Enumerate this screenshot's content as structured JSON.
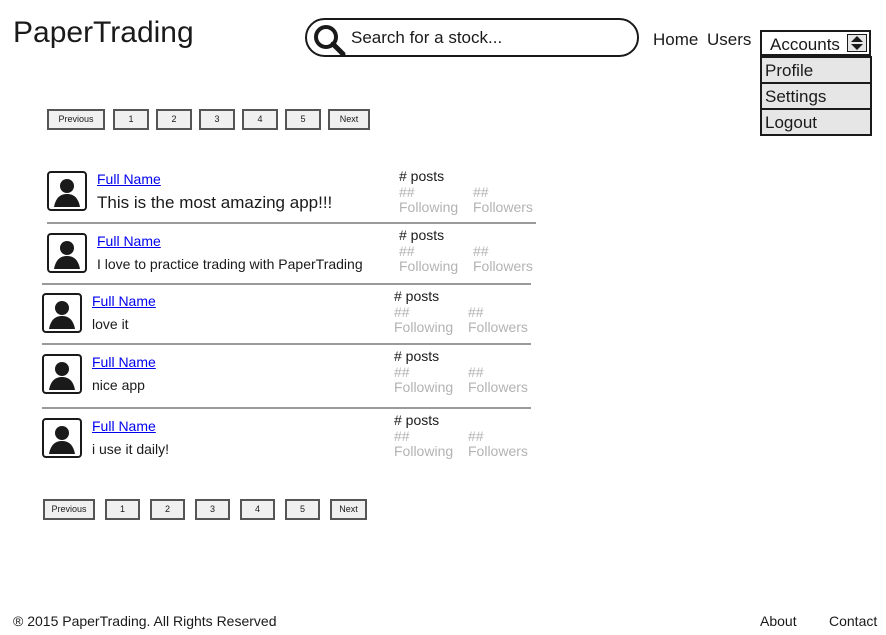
{
  "header": {
    "logo": "PaperTrading",
    "search_placeholder": "Search for a stock...",
    "nav": {
      "home": "Home",
      "users": "Users"
    },
    "accounts": {
      "label": "Accounts",
      "menu": [
        "Profile",
        "Settings",
        "Logout"
      ]
    }
  },
  "pager_top": {
    "previous": "Previous",
    "pages": [
      "1",
      "2",
      "3",
      "4",
      "5"
    ],
    "next": "Next"
  },
  "pager_bottom": {
    "previous": "Previous",
    "pages": [
      "1",
      "2",
      "3",
      "4",
      "5"
    ],
    "next": "Next"
  },
  "posts": [
    {
      "name": "Full Name",
      "text": "This is the most amazing app!!!",
      "posts_label": "# posts",
      "following_count": "##",
      "following_label": "Following",
      "followers_count": "##",
      "followers_label": "Followers"
    },
    {
      "name": "Full Name",
      "text": "I love to practice trading with PaperTrading",
      "posts_label": "# posts",
      "following_count": "##",
      "following_label": "Following",
      "followers_count": "##",
      "followers_label": "Followers"
    },
    {
      "name": "Full Name",
      "text": "love it",
      "posts_label": "# posts",
      "following_count": "##",
      "following_label": "Following",
      "followers_count": "##",
      "followers_label": "Followers"
    },
    {
      "name": "Full Name",
      "text": "nice app",
      "posts_label": "# posts",
      "following_count": "##",
      "following_label": "Following",
      "followers_count": "##",
      "followers_label": "Followers"
    },
    {
      "name": "Full Name",
      "text": "i use it daily!",
      "posts_label": "# posts",
      "following_count": "##",
      "following_label": "Following",
      "followers_count": "##",
      "followers_label": "Followers"
    }
  ],
  "footer": {
    "copyright": "® 2015 PaperTrading. All Rights Reserved",
    "about": "About",
    "contact": "Contact"
  }
}
